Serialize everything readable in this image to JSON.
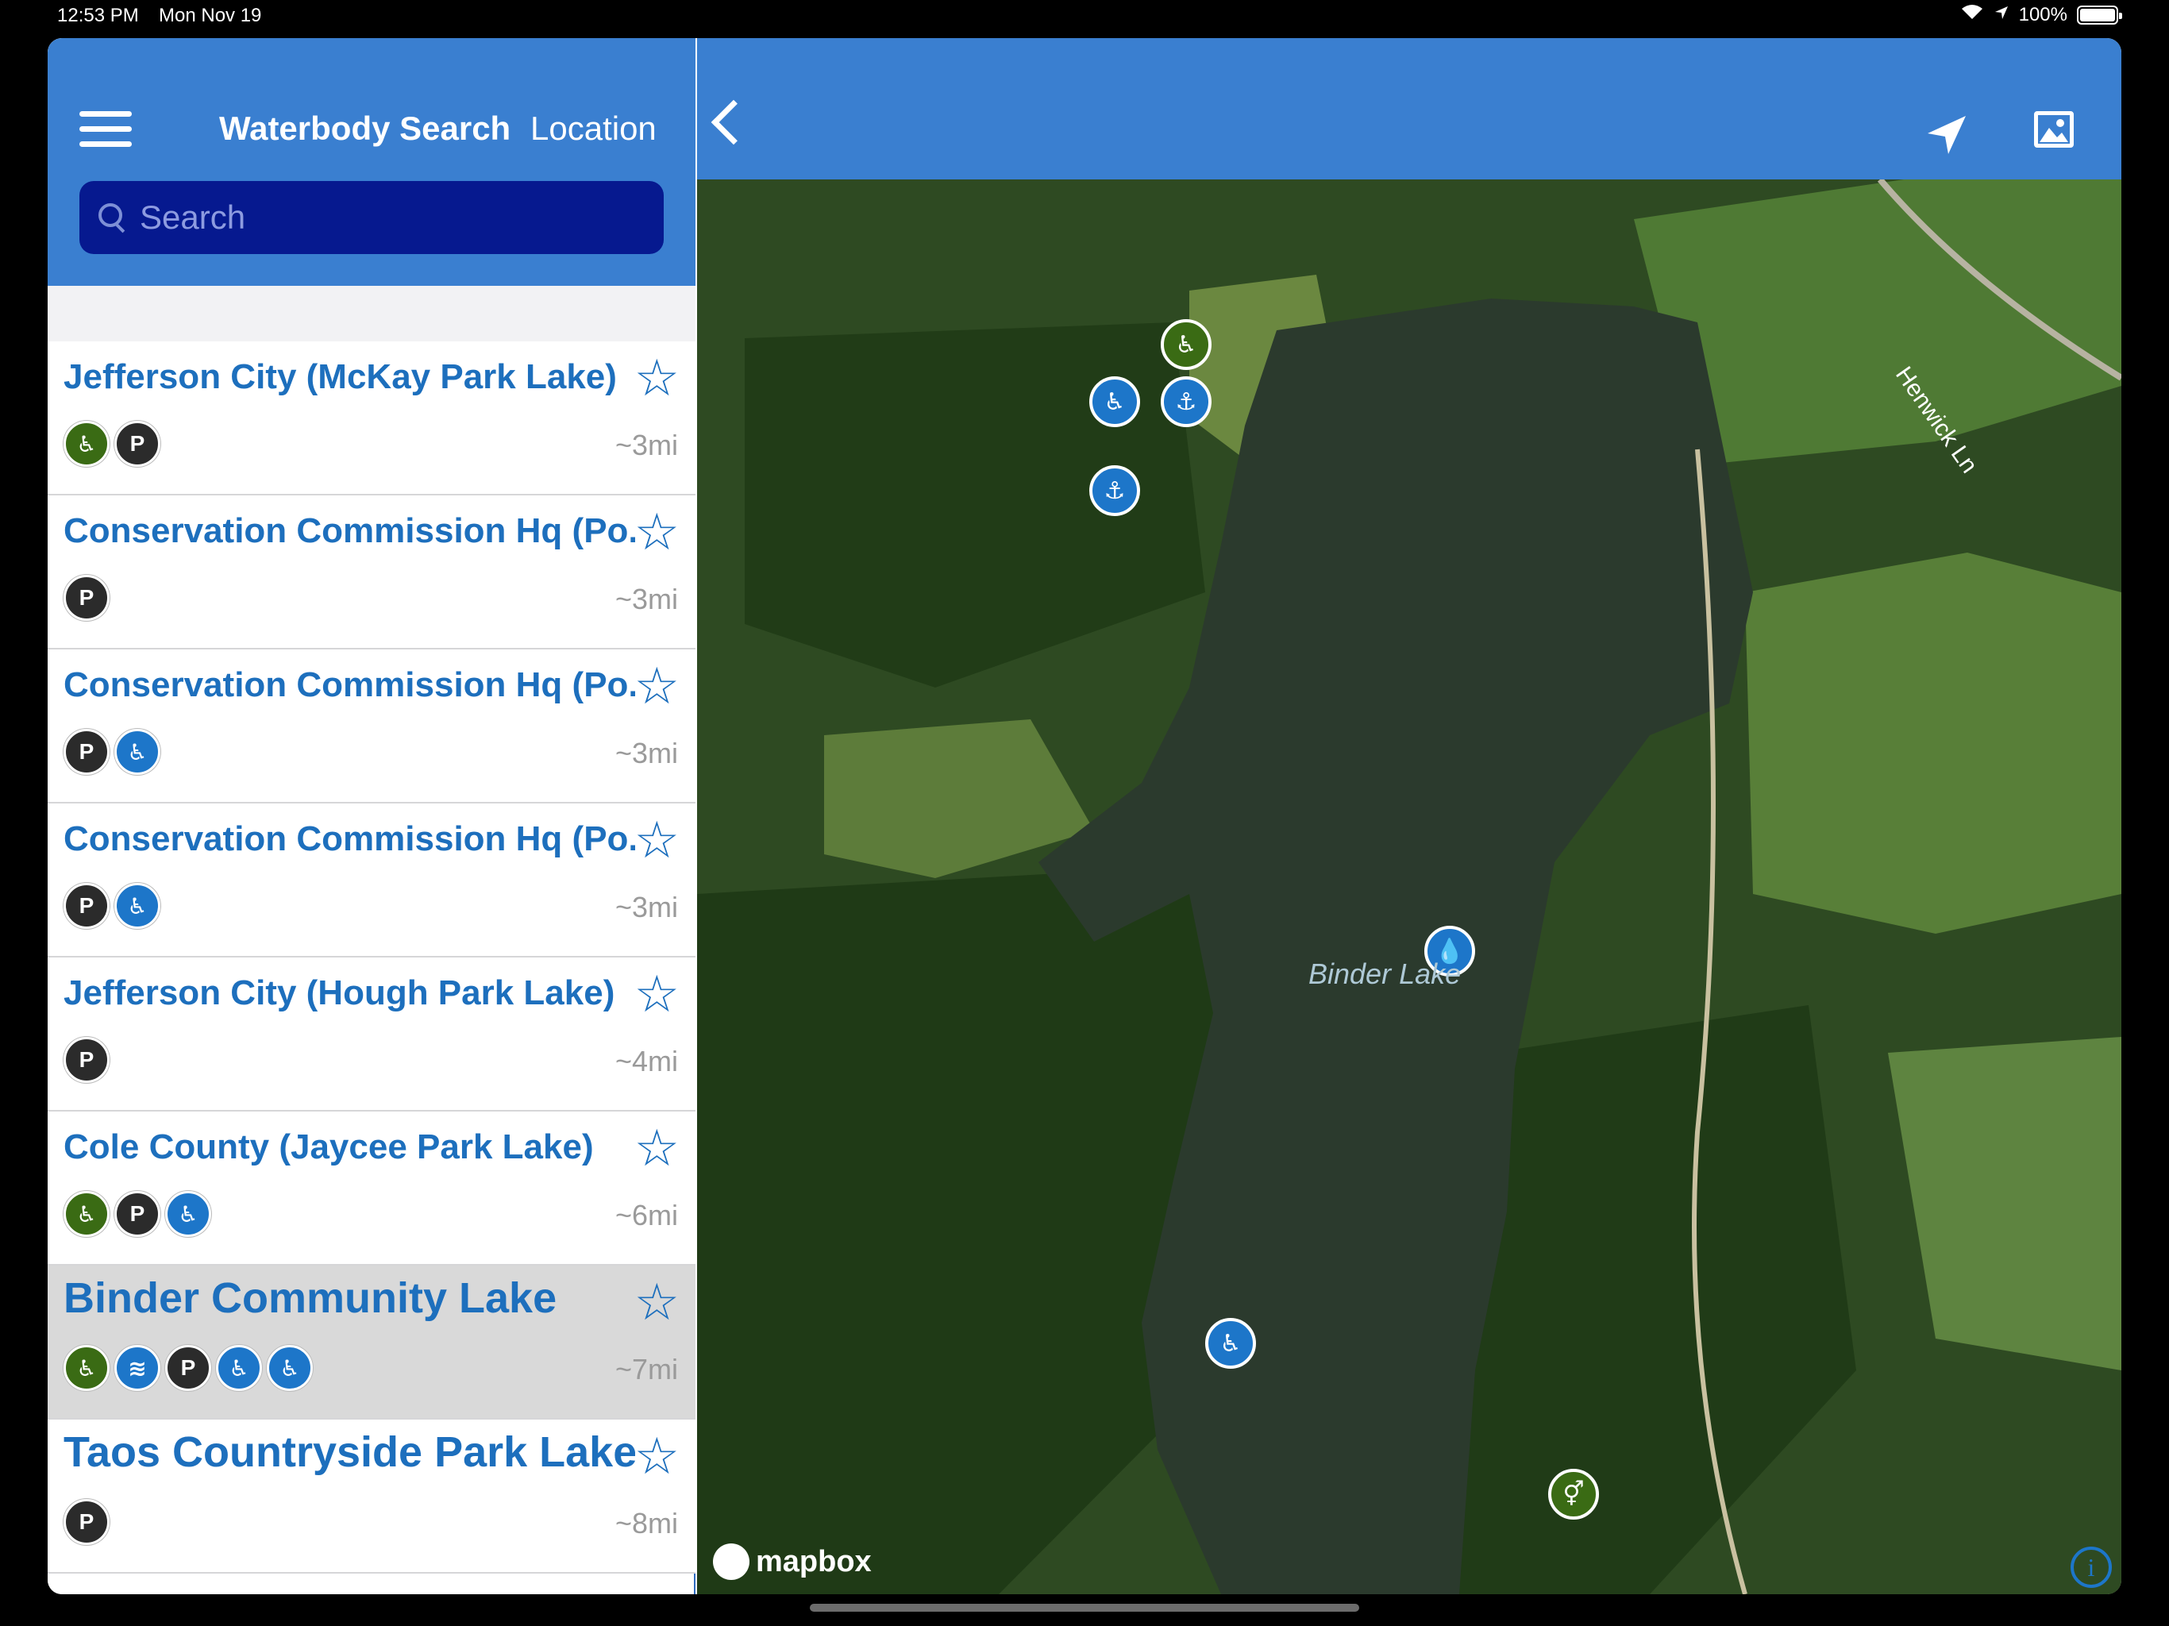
{
  "status": {
    "time": "12:53 PM",
    "date": "Mon Nov 19",
    "battery": "100%"
  },
  "left": {
    "title": "Waterbody Search",
    "subtitle": "Location",
    "search_placeholder": "Search",
    "items": [
      {
        "name": "Jefferson City (McKay Park Lake)",
        "distance": "~3mi",
        "icons": [
          "accessible-restroom-icon",
          "accessible-parking-icon"
        ]
      },
      {
        "name": "Conservation Commission Hq (Po...",
        "distance": "~3mi",
        "icons": [
          "accessible-parking-icon"
        ]
      },
      {
        "name": "Conservation Commission Hq (Po...",
        "distance": "~3mi",
        "icons": [
          "accessible-parking-icon",
          "accessible-fishing-icon"
        ]
      },
      {
        "name": "Conservation Commission Hq (Po...",
        "distance": "~3mi",
        "icons": [
          "accessible-parking-icon",
          "accessible-fishing-icon"
        ]
      },
      {
        "name": "Jefferson City (Hough Park Lake)",
        "distance": "~4mi",
        "icons": [
          "parking-icon"
        ]
      },
      {
        "name": "Cole County (Jaycee Park Lake)",
        "distance": "~6mi",
        "icons": [
          "accessible-restroom-icon",
          "accessible-parking-icon",
          "accessible-fishing-icon"
        ]
      },
      {
        "name": "Binder Community Lake",
        "distance": "~7mi",
        "icons": [
          "accessible-restroom-icon",
          "boat-ramp-icon",
          "accessible-parking-icon",
          "accessible-fishing-icon",
          "accessible-fishing-icon"
        ],
        "selected": true
      },
      {
        "name": "Taos Countryside Park Lake",
        "distance": "~8mi",
        "icons": [
          "parking-icon"
        ]
      }
    ]
  },
  "map": {
    "lake_label": "Binder Lake",
    "road_label": "Henwick Ln",
    "attribution": "mapbox",
    "info": "i"
  },
  "colors": {
    "header": "#3a7fd0",
    "search_bg": "#06198f",
    "link": "#1d6fbd",
    "green_icon": "#3a6b14",
    "dark_icon": "#2b2b2b",
    "blue_icon": "#1d76c9"
  }
}
